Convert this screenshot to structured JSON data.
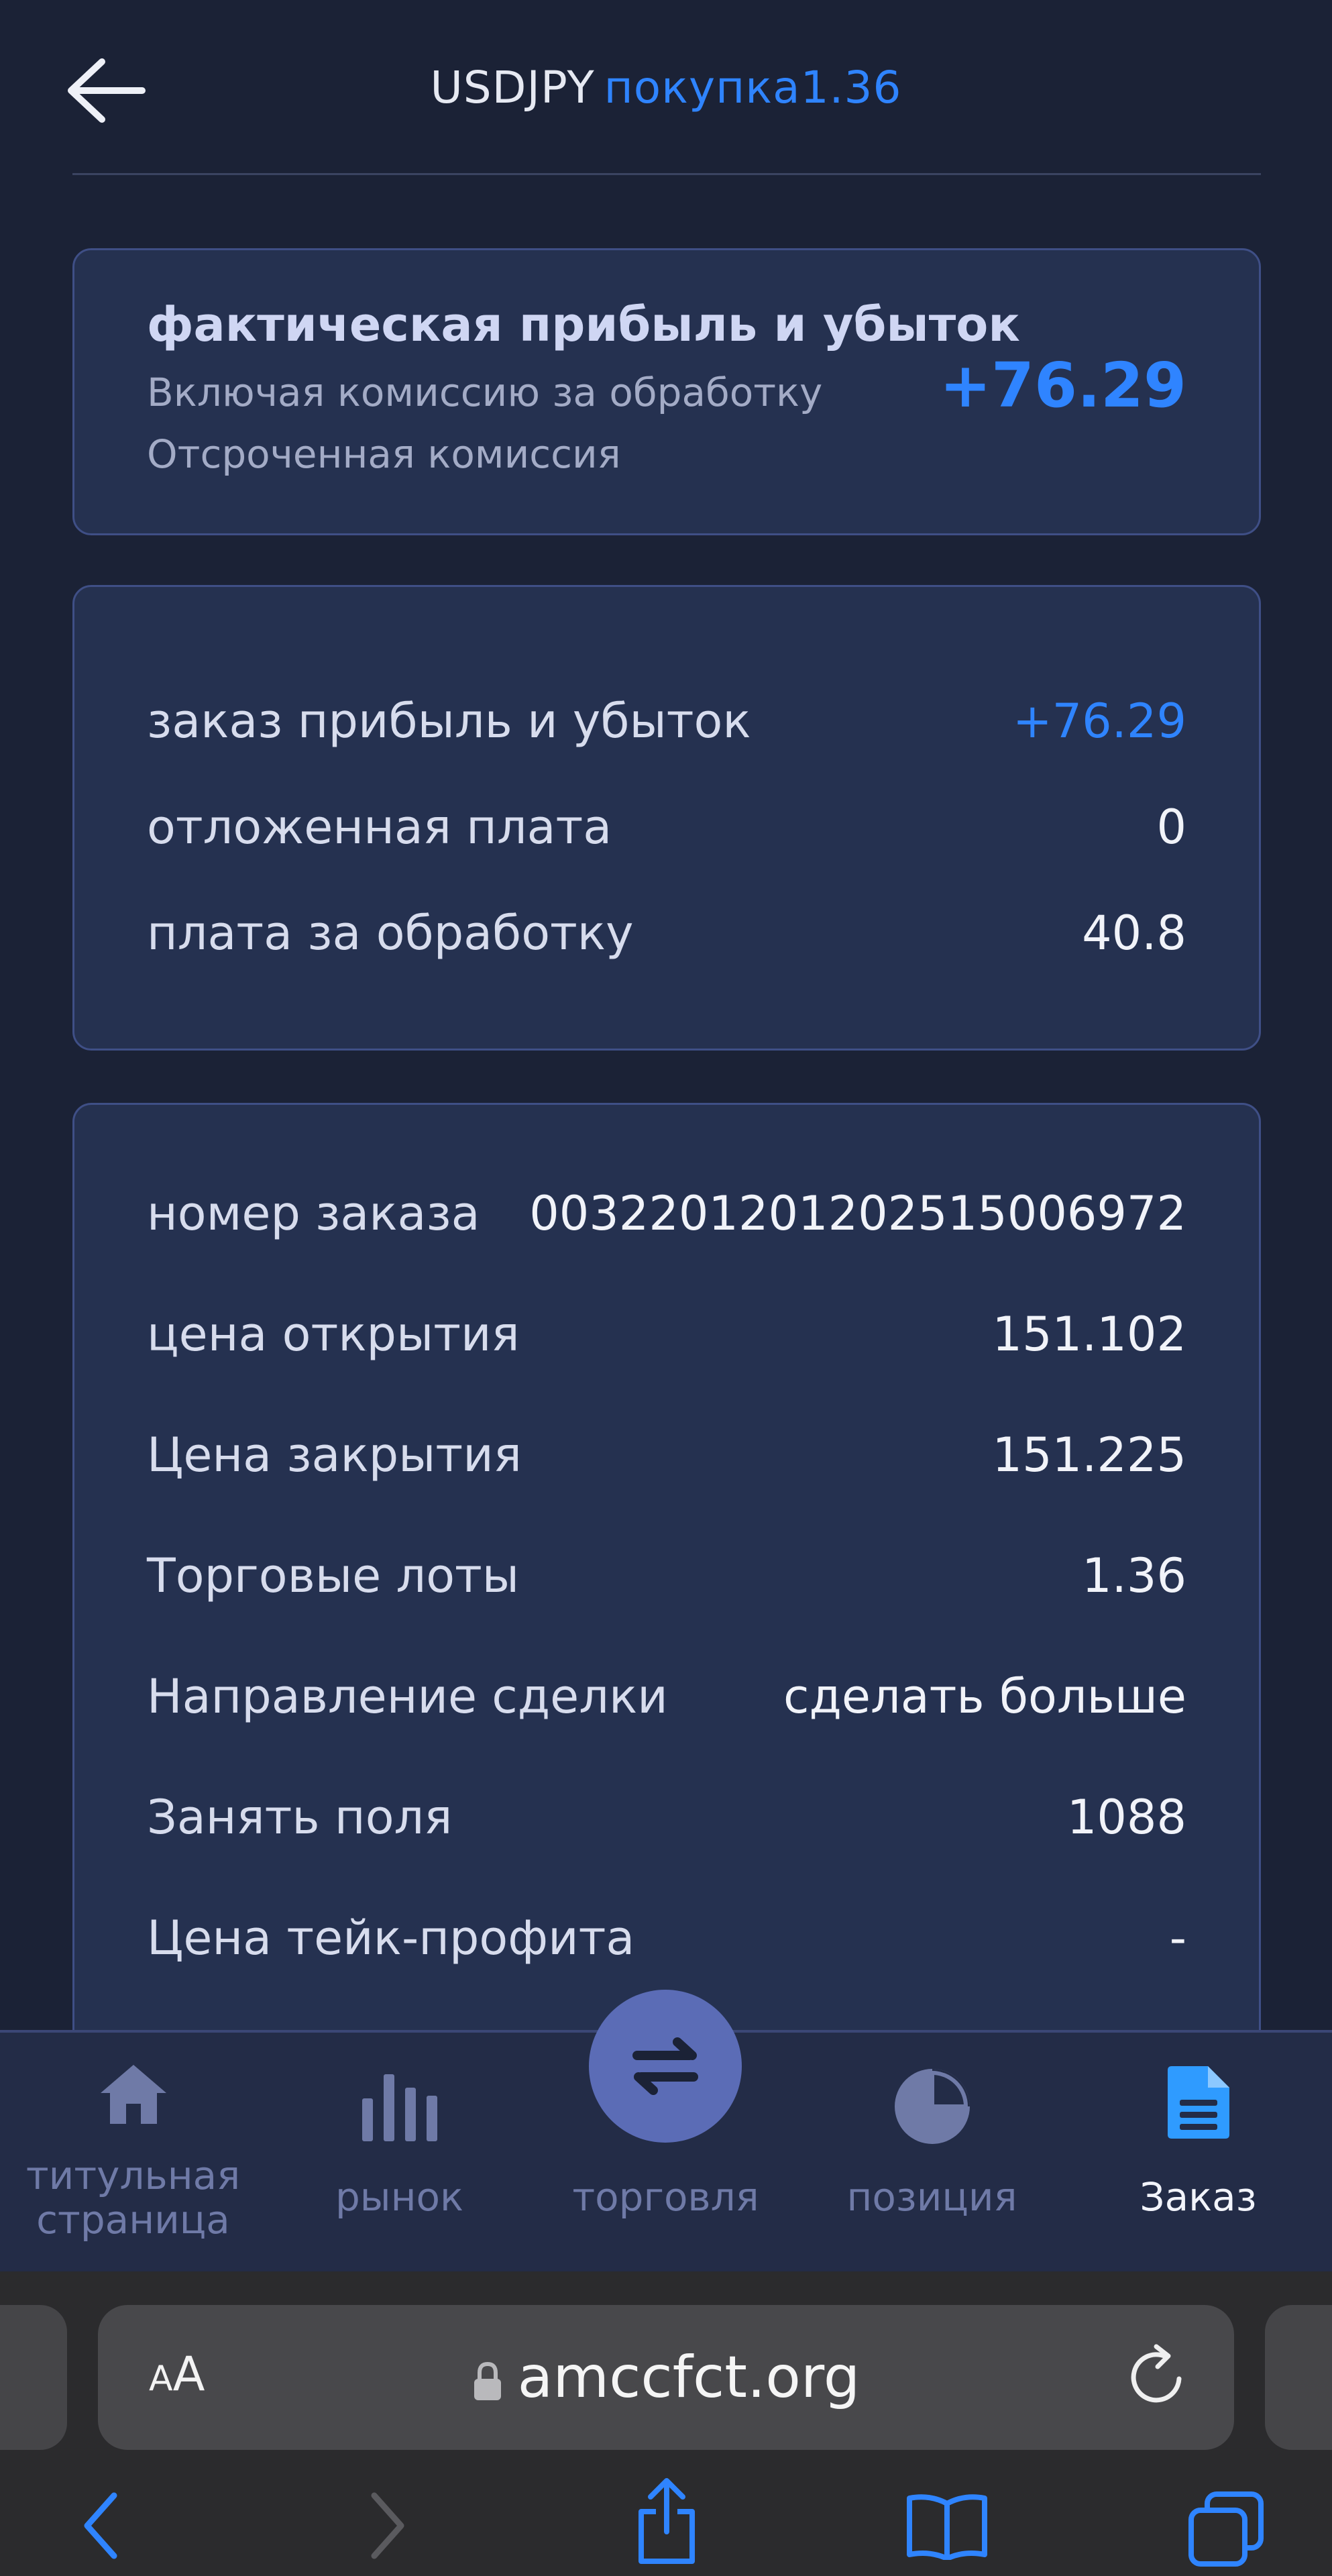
{
  "header": {
    "symbol": "USDJPY",
    "direction": "покупка",
    "lots": "1.36"
  },
  "pnl_card": {
    "title": "фактическая прибыль и убыток",
    "subtitle1": "Включая комиссию за обработку",
    "subtitle2": "Отсроченная комиссия",
    "value": "+76.29"
  },
  "fees_card": {
    "rows": [
      {
        "label": "заказ прибыль и убыток",
        "value": "+76.29"
      },
      {
        "label": "отложенная плата",
        "value": "0"
      },
      {
        "label": "плата за обработку",
        "value": "40.8"
      }
    ]
  },
  "details_card": {
    "rows": [
      {
        "label": "номер заказа",
        "value": "003220120120251500​6972"
      },
      {
        "label": "цена открытия",
        "value": "151.102"
      },
      {
        "label": "Цена закрытия",
        "value": "151.225"
      },
      {
        "label": "Торговые лоты",
        "value": "1.36"
      },
      {
        "label": "Направление сделки",
        "value": "сделать больше"
      },
      {
        "label": "Занять поля",
        "value": "1088"
      },
      {
        "label": "Цена тейк-профита",
        "value": "-"
      }
    ]
  },
  "tabbar": {
    "home_line1": "титульная",
    "home_line2": "страница",
    "market": "рынок",
    "trade": "торговля",
    "position": "позиция",
    "order": "Заказ",
    "active": "Заказ"
  },
  "browser": {
    "aa_small": "A",
    "aa_big": "A",
    "url": "amccfct.org"
  },
  "colors": {
    "accent": "#2f84ff",
    "background": "#1b2236",
    "card": "#253150"
  }
}
